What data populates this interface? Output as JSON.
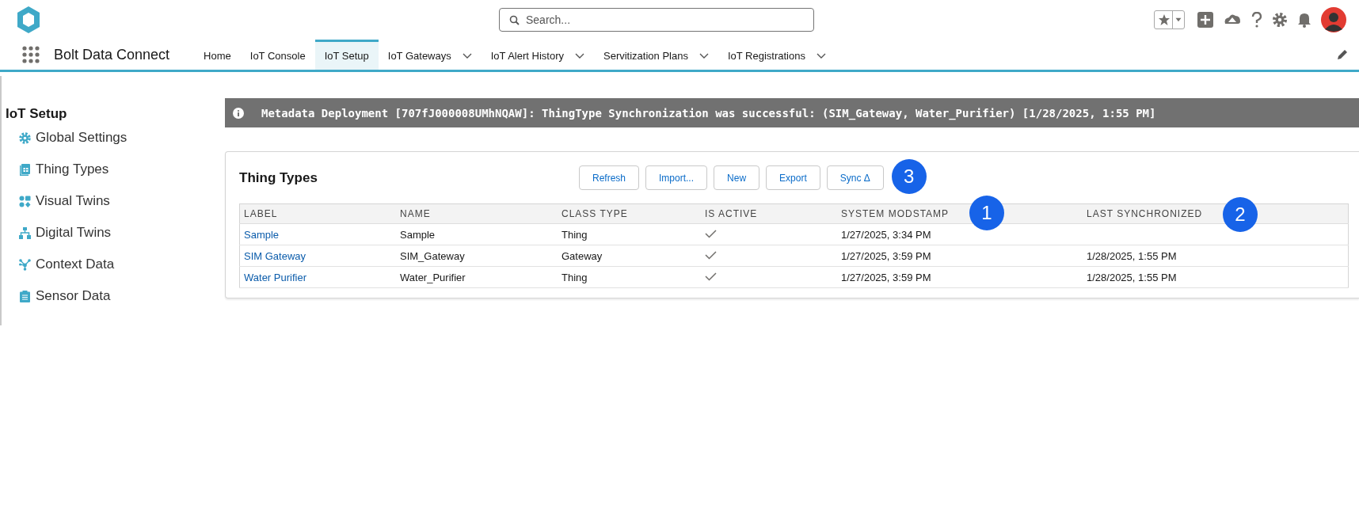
{
  "header": {
    "search": {
      "placeholder": "Search..."
    }
  },
  "app": {
    "title": "Bolt Data Connect"
  },
  "nav_tabs": [
    {
      "label": "Home",
      "selected": false,
      "dropdown": false
    },
    {
      "label": "IoT Console",
      "selected": false,
      "dropdown": false
    },
    {
      "label": "IoT Setup",
      "selected": true,
      "dropdown": false
    },
    {
      "label": "IoT Gateways",
      "selected": false,
      "dropdown": true
    },
    {
      "label": "IoT Alert History",
      "selected": false,
      "dropdown": true
    },
    {
      "label": "Servitization Plans",
      "selected": false,
      "dropdown": true
    },
    {
      "label": "IoT Registrations",
      "selected": false,
      "dropdown": true
    }
  ],
  "sidebar": {
    "title": "IoT Setup",
    "items": [
      {
        "label": "Global Settings",
        "kind": "settings"
      },
      {
        "label": "Thing Types",
        "kind": "types"
      },
      {
        "label": "Visual Twins",
        "kind": "visual"
      },
      {
        "label": "Digital Twins",
        "kind": "hierarchy"
      },
      {
        "label": "Context Data",
        "kind": "network"
      },
      {
        "label": "Sensor Data",
        "kind": "clipboard"
      }
    ]
  },
  "banner": {
    "message": "Metadata Deployment [707fJ000008UMhNQAW]: ThingType Synchronization was successful: (SIM_Gateway, Water_Purifier) [1/28/2025, 1:55 PM]"
  },
  "card": {
    "title": "Thing Types",
    "buttons": [
      "Refresh",
      "Import...",
      "New",
      "Export",
      "Sync Δ"
    ],
    "table": {
      "columns": [
        "LABEL",
        "NAME",
        "CLASS TYPE",
        "IS ACTIVE",
        "SYSTEM MODSTAMP",
        "LAST SYNCHRONIZED"
      ],
      "rows": [
        {
          "label": "Sample",
          "name": "Sample",
          "class_type": "Thing",
          "is_active": true,
          "system_modstamp": "1/27/2025, 3:34 PM"
        },
        {
          "label": "SIM Gateway",
          "name": "SIM_Gateway",
          "class_type": "Gateway",
          "is_active": true,
          "system_modstamp": "1/27/2025, 3:59 PM",
          "last_synchronized": "1/28/2025, 1:55 PM"
        },
        {
          "label": "Water Purifier",
          "name": "Water_Purifier",
          "class_type": "Thing",
          "is_active": true,
          "system_modstamp": "1/27/2025, 3:59 PM",
          "last_synchronized": "1/28/2025, 1:55 PM"
        }
      ]
    }
  },
  "callouts": [
    {
      "label": "1",
      "kind": "overlay"
    },
    {
      "label": "2",
      "kind": "overlay"
    },
    {
      "label": "3",
      "kind": "inline"
    }
  ]
}
